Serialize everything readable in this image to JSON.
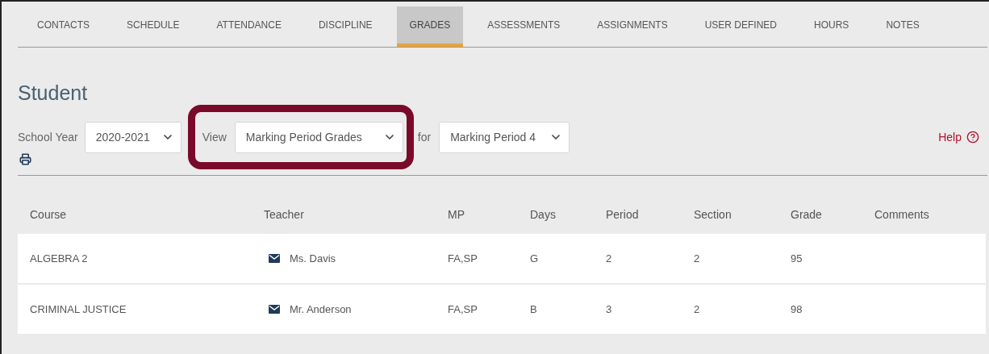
{
  "tabs": [
    {
      "label": "CONTACTS",
      "selected": false
    },
    {
      "label": "SCHEDULE",
      "selected": false
    },
    {
      "label": "ATTENDANCE",
      "selected": false
    },
    {
      "label": "DISCIPLINE",
      "selected": false
    },
    {
      "label": "GRADES",
      "selected": true
    },
    {
      "label": "ASSESSMENTS",
      "selected": false
    },
    {
      "label": "ASSIGNMENTS",
      "selected": false
    },
    {
      "label": "USER DEFINED",
      "selected": false
    },
    {
      "label": "HOURS",
      "selected": false
    },
    {
      "label": "NOTES",
      "selected": false
    }
  ],
  "title": "Student",
  "filters": {
    "school_year_label": "School Year",
    "school_year": "2020-2021",
    "view_label": "View",
    "view": "Marking Period Grades",
    "view_highlighted": true,
    "for_label": "for",
    "period": "Marking Period 4"
  },
  "help": "Help",
  "table": {
    "columns": [
      "Course",
      "Teacher",
      "MP",
      "Days",
      "Period",
      "Section",
      "Grade",
      "Comments"
    ],
    "rows": [
      {
        "course": "ALGEBRA 2",
        "teacher": "Ms. Davis",
        "mp": "FA,SP",
        "days": "G",
        "period": "2",
        "section": "2",
        "grade": "95"
      },
      {
        "course": "CRIMINAL JUSTICE",
        "teacher": "Mr. Anderson",
        "mp": "FA,SP",
        "days": "B",
        "period": "3",
        "section": "2",
        "grade": "98"
      }
    ]
  }
}
